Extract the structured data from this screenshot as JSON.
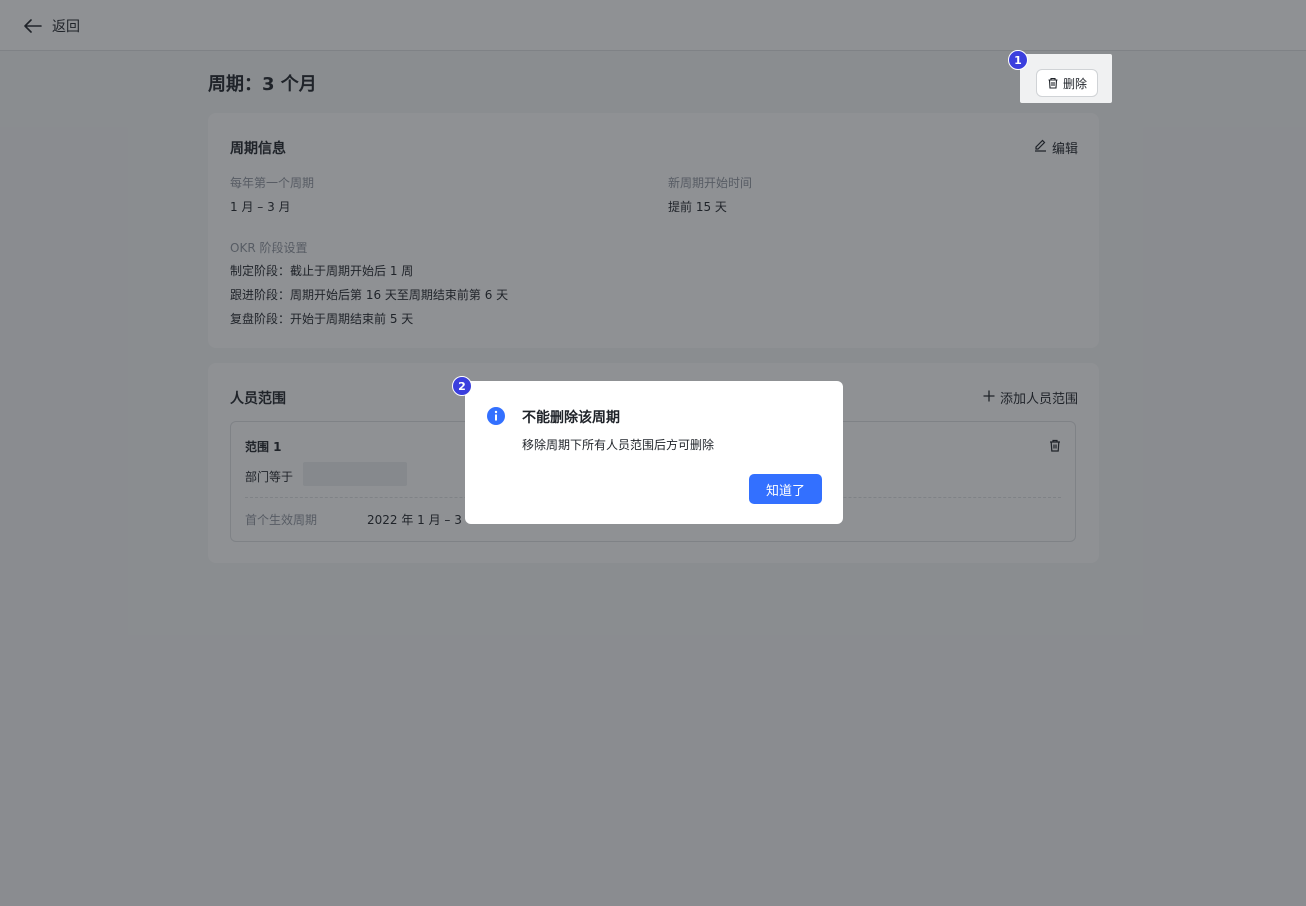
{
  "topbar": {
    "back_label": "返回"
  },
  "page": {
    "title": "周期：3 个月",
    "delete_label": "删除"
  },
  "cycle_info": {
    "title": "周期信息",
    "edit_label": "编辑",
    "first_cycle_label": "每年第一个周期",
    "first_cycle_value": "1 月 – 3 月",
    "new_cycle_start_label": "新周期开始时间",
    "new_cycle_start_value": "提前 15 天",
    "okr_stage_label": "OKR 阶段设置",
    "stages": [
      "制定阶段：截止于周期开始后 1 周",
      "跟进阶段：周期开始后第 16 天至周期结束前第 6 天",
      "复盘阶段：开始于周期结束前 5 天"
    ]
  },
  "member_scope": {
    "title": "人员范围",
    "add_label": "添加人员范围",
    "scopes": [
      {
        "name": "范围 1",
        "department_label": "部门等于",
        "first_effective_label": "首个生效周期",
        "first_effective_value": "2022 年 1 月 – 3"
      }
    ]
  },
  "dialog": {
    "title": "不能删除该周期",
    "message": "移除周期下所有人员范围后方可删除",
    "ok_label": "知道了"
  },
  "annotations": {
    "badge_1": "1",
    "badge_2": "2"
  },
  "colors": {
    "primary": "#3370ff",
    "badge": "#3b3fde",
    "overlay": "rgba(31,35,41,0.5)"
  }
}
